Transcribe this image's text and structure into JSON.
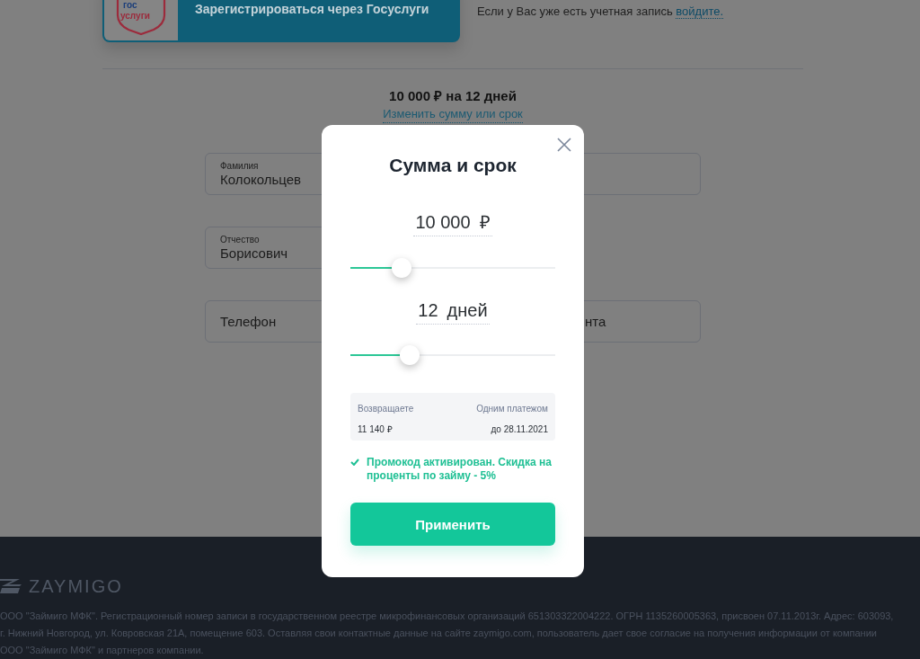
{
  "top_card": {
    "logo_lines": [
      "гос",
      "услуги"
    ],
    "button": "Зарегистрироваться через Госуслуги"
  },
  "login_prompt": {
    "text": "Если у Вас уже есть учетная запись",
    "link": "войдите."
  },
  "summary": {
    "title": "10 000 ₽ на 12 дней",
    "link": "Изменить сумму или срок"
  },
  "form_rows": [
    {
      "left": {
        "label": "Фамилия",
        "value": "Колокольцев"
      },
      "right": {}
    },
    {
      "left": {
        "label": "Отчество",
        "value": "Борисович"
      }
    },
    {
      "left": {
        "placeholder": "Телефон"
      },
      "right": {
        "placeholder": "нта"
      }
    }
  ],
  "modal": {
    "title": "Сумма и срок",
    "amount": {
      "value": "10 000",
      "unit": "₽",
      "level": 0.25
    },
    "term": {
      "value": "12",
      "unit": "дней",
      "level": 0.29
    },
    "repayment": {
      "label": "Возвращаете",
      "value": "11 140 ₽",
      "mode_label": "Одним платежом",
      "due": "до 28.11.2021"
    },
    "promo": "Промокод активирован. Скидка на проценты по займу - 5%",
    "button": "Применить"
  },
  "footer": {
    "logo": "ZAYMIGO",
    "legal": "ООО \"Займиго МФК\". Регистрационный номер записи в государственном реестре микрофинансовых организаций 651303322004222. ОГРН 1135260005363, присвоен 07.11.2013г. Адрес: 603093, г. Нижний Новгород, ул. Ковровская 21А, помещение 603. Оставляя свои контактные данные на сайте zaymigo.com, пользователь дает свое согласие на получения информации от компании ООО \"Займиго МФК\" и партнеров компании."
  }
}
